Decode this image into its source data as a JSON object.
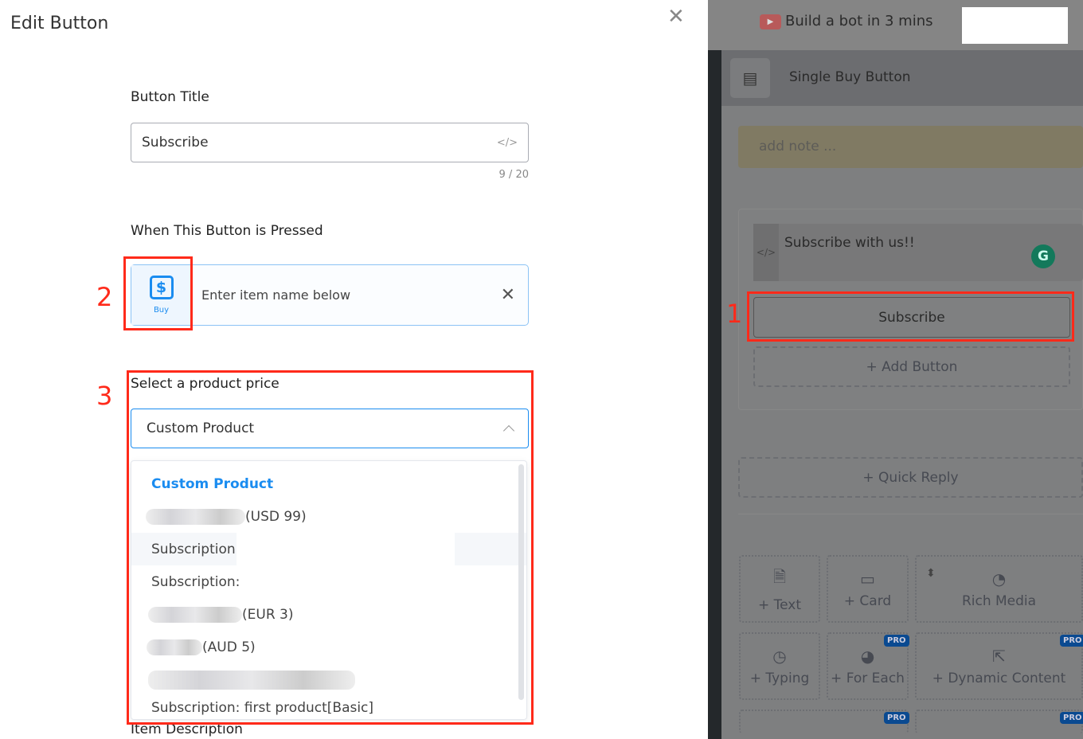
{
  "modal": {
    "title": "Edit Button",
    "close_icon": "close-icon",
    "button_title": {
      "label": "Button Title",
      "value": "Subscribe",
      "counter": "9 / 20"
    },
    "pressed": {
      "label": "When This Button is Pressed",
      "action_label": "Buy",
      "placeholder": "Enter item name below"
    },
    "price": {
      "label": "Select a product price",
      "selected": "Custom Product",
      "options": [
        {
          "label": "Custom Product",
          "selected": true
        },
        {
          "suffix": "(USD 99)",
          "redacted": true
        },
        {
          "label": "Subscription:",
          "hover": true
        },
        {
          "label": "Subscription:"
        },
        {
          "suffix": "(EUR 3)",
          "redacted": true
        },
        {
          "suffix": "(AUD 5)",
          "redacted": true
        },
        {
          "suffix": "",
          "redacted": true
        },
        {
          "label": "Subscription: first product[Basic]"
        }
      ]
    },
    "next_label": "Item Description"
  },
  "annotations": {
    "one": "1",
    "two": "2",
    "three": "3",
    "color": "#ff2a1a"
  },
  "background": {
    "video_link": "Build a bot in 3 mins",
    "card_title": "Single Buy Button",
    "note_placeholder": "add note ...",
    "message": "Subscribe with us!!",
    "button": "Subscribe",
    "add_button": "+ Add Button",
    "quick_reply": "+ Quick Reply",
    "tiles": [
      {
        "label": "+ Text",
        "icon": "document-icon"
      },
      {
        "label": "+ Card",
        "icon": "card-stack-icon"
      },
      {
        "label": "Rich Media",
        "icon": "image-icon"
      },
      {
        "label": "+ Typing",
        "icon": "clock-icon"
      },
      {
        "label": "+ For Each",
        "icon": "pie-icon",
        "pro": "PRO"
      },
      {
        "label": "+ Dynamic Content",
        "icon": "external-link-icon",
        "pro": "PRO"
      }
    ],
    "pro_badge": "PRO"
  },
  "colors": {
    "accent": "#1a8cf0",
    "overlay": "#7e7f80"
  }
}
